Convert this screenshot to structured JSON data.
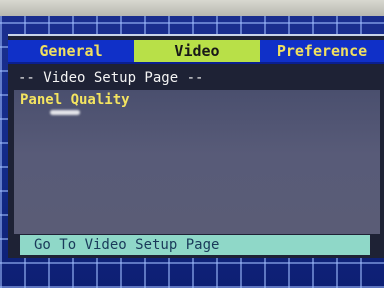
{
  "tabs": [
    {
      "label": "General"
    },
    {
      "label": "Video"
    },
    {
      "label": "Preference"
    }
  ],
  "active_tab": "Video",
  "page": {
    "title": "-- Video Setup Page --"
  },
  "items": [
    {
      "label": "Panel Quality"
    }
  ],
  "status": {
    "text": "Go To Video Setup Page"
  },
  "colors": {
    "tab_bg": "#1030c8",
    "active_tab_bg": "#b8e048",
    "item_text": "#f4e460",
    "status_bg": "#8fd8c8"
  }
}
